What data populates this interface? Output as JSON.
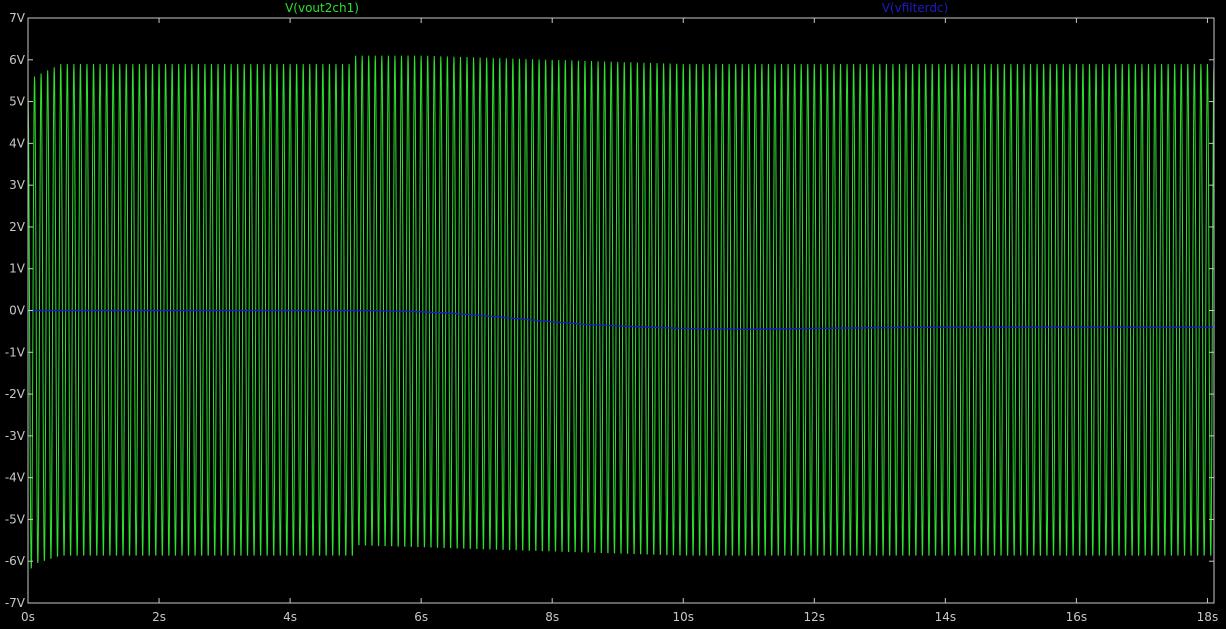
{
  "window": {
    "background": "#000000",
    "frame_color": "#c8c8c8",
    "tick_color": "#c8c8c8"
  },
  "legend": [
    {
      "label": "V(vout2ch1)",
      "color": "#2ee02e"
    },
    {
      "label": "V(vfilterdc)",
      "color": "#1c1cc8"
    }
  ],
  "chart_data": {
    "type": "line",
    "title": "",
    "xlabel": "",
    "ylabel": "",
    "xlim": [
      0,
      18.1
    ],
    "ylim": [
      -7,
      7
    ],
    "grid": false,
    "x_ticks": [
      0,
      2,
      4,
      6,
      8,
      10,
      12,
      14,
      16,
      18
    ],
    "x_tick_labels": [
      "0s",
      "2s",
      "4s",
      "6s",
      "8s",
      "10s",
      "12s",
      "14s",
      "16s",
      "18s"
    ],
    "y_ticks": [
      7,
      6,
      5,
      4,
      3,
      2,
      1,
      0,
      -1,
      -2,
      -3,
      -4,
      -5,
      -6,
      -7
    ],
    "y_tick_labels": [
      "7V",
      "6V",
      "5V",
      "4V",
      "3V",
      "2V",
      "1V",
      "0V",
      "-1V",
      "-2V",
      "-3V",
      "-4V",
      "-5V",
      "-6V",
      "-7V"
    ],
    "series": [
      {
        "name": "V(vout2ch1)",
        "color": "#2ee02e",
        "kind": "oscillation",
        "frequency_hz": 10,
        "envelope": {
          "t": [
            0,
            0.1,
            0.5,
            4.99,
            5.0,
            6.0,
            7.0,
            8.0,
            9.0,
            10.0,
            12.0,
            14.0,
            16.0,
            18.1
          ],
          "max": [
            5.1,
            5.6,
            5.9,
            5.9,
            6.1,
            6.1,
            6.05,
            6.0,
            5.95,
            5.9,
            5.9,
            5.9,
            5.9,
            5.9
          ],
          "min": [
            -6.3,
            -6.1,
            -5.9,
            -5.9,
            -5.65,
            -5.7,
            -5.75,
            -5.8,
            -5.85,
            -5.9,
            -5.9,
            -5.9,
            -5.9,
            -5.9
          ]
        }
      },
      {
        "name": "V(vfilterdc)",
        "color": "#1c1cc8",
        "kind": "line",
        "x": [
          0,
          1,
          2,
          3,
          4,
          5,
          5.5,
          6,
          6.5,
          7,
          7.5,
          8,
          8.5,
          9,
          10,
          11,
          12,
          13,
          14,
          15,
          16,
          17,
          18.1
        ],
        "y": [
          0.0,
          0.0,
          0.0,
          0.0,
          0.0,
          0.0,
          -0.01,
          -0.03,
          -0.07,
          -0.13,
          -0.2,
          -0.27,
          -0.33,
          -0.37,
          -0.43,
          -0.45,
          -0.43,
          -0.41,
          -0.4,
          -0.4,
          -0.4,
          -0.4,
          -0.4
        ]
      }
    ]
  }
}
